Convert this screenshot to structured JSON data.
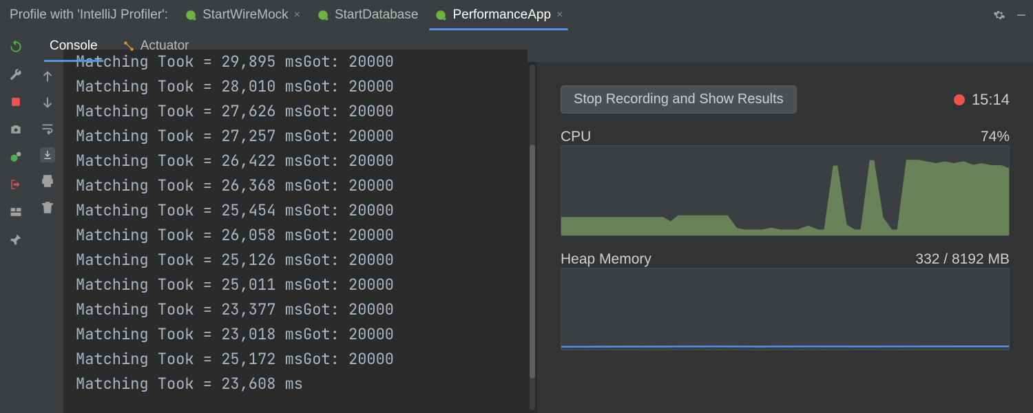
{
  "topbar": {
    "label": "Profile with 'IntelliJ Profiler':",
    "tabs": [
      {
        "label": "StartWireMock",
        "active": false,
        "closable": true
      },
      {
        "label": "StartDatabase",
        "active": false,
        "closable": false
      },
      {
        "label": "PerformanceApp",
        "active": true,
        "closable": true
      }
    ]
  },
  "console_tabs": [
    {
      "label": "Console",
      "active": true
    },
    {
      "label": "Actuator",
      "active": false
    }
  ],
  "console_lines": [
    "Matching Took = 29,895 msGot: 20000",
    "Matching Took = 28,010 msGot: 20000",
    "Matching Took = 27,626 msGot: 20000",
    "Matching Took = 27,257 msGot: 20000",
    "Matching Took = 26,422 msGot: 20000",
    "Matching Took = 26,368 msGot: 20000",
    "Matching Took = 25,454 msGot: 20000",
    "Matching Took = 26,058 msGot: 20000",
    "Matching Took = 25,126 msGot: 20000",
    "Matching Took = 25,011 msGot: 20000",
    "Matching Took = 23,377 msGot: 20000",
    "Matching Took = 23,018 msGot: 20000",
    "Matching Took = 25,172 msGot: 20000",
    "Matching Took = 23,608 ms"
  ],
  "profiler": {
    "stop_label": "Stop Recording and Show Results",
    "elapsed": "15:14",
    "cpu": {
      "label": "CPU",
      "value": "74%"
    },
    "heap": {
      "label": "Heap Memory",
      "value": "332 / 8192 MB"
    }
  },
  "chart_data": [
    {
      "type": "area",
      "title": "CPU",
      "ylabel": "%",
      "ylim": [
        0,
        100
      ],
      "x": [
        0,
        1,
        2,
        3,
        4,
        5,
        6,
        7,
        8,
        9,
        10,
        11,
        12,
        13,
        14,
        15,
        16,
        17,
        18,
        19,
        20,
        21,
        22,
        23,
        24,
        25,
        26,
        27,
        28,
        29,
        30,
        31,
        32,
        33,
        34,
        35,
        36,
        37,
        38,
        39,
        40,
        41,
        42,
        43,
        44,
        45,
        46,
        47,
        48,
        49
      ],
      "values": [
        20,
        20,
        20,
        20,
        20,
        20,
        20,
        20,
        20,
        20,
        20,
        20,
        14,
        22,
        22,
        22,
        22,
        22,
        22,
        8,
        6,
        6,
        6,
        8,
        6,
        6,
        6,
        10,
        6,
        6,
        78,
        12,
        6,
        6,
        84,
        20,
        6,
        6,
        84,
        84,
        82,
        80,
        82,
        80,
        82,
        78,
        80,
        78,
        78,
        74
      ]
    },
    {
      "type": "line",
      "title": "Heap Memory",
      "ylabel": "MB",
      "ylim": [
        0,
        8192
      ],
      "x": [
        0,
        1,
        2,
        3,
        4,
        5,
        6,
        7,
        8,
        9
      ],
      "values": [
        300,
        310,
        320,
        330,
        320,
        330,
        325,
        330,
        335,
        332
      ]
    }
  ]
}
